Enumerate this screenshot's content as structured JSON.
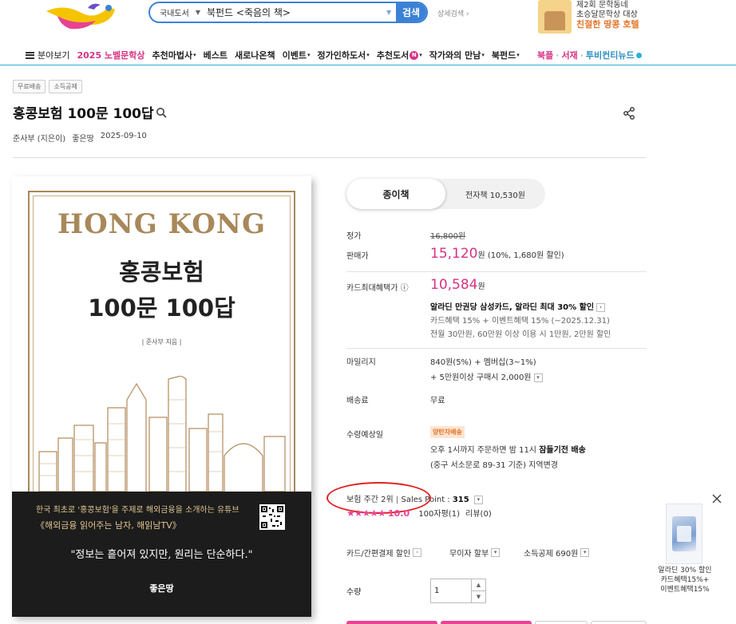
{
  "header": {
    "search_scope": "국내도서",
    "search_value": "북펀드 <죽음의 책>",
    "search_button": "검색",
    "advanced_search": "상세검색",
    "promo_lines": [
      "제2회 문학동네",
      "초승달문학상 대상"
    ],
    "promo_highlight": "친절한 땅콩 호텔"
  },
  "nav": {
    "items": [
      {
        "label": "분야보기",
        "dropdown": false
      },
      {
        "label": "2025 노벨문학상",
        "dropdown": false
      },
      {
        "label": "추천마법사",
        "dropdown": true
      },
      {
        "label": "베스트",
        "dropdown": false
      },
      {
        "label": "새로나온책",
        "dropdown": false
      },
      {
        "label": "이벤트",
        "dropdown": true
      },
      {
        "label": "정가인하도서",
        "dropdown": true
      },
      {
        "label": "추천도서",
        "dropdown": true,
        "badge": "N"
      },
      {
        "label": "작가와의 만남",
        "dropdown": true
      },
      {
        "label": "북펀드",
        "dropdown": true
      }
    ],
    "right": [
      "북플",
      "서재",
      "투비컨티뉴드"
    ]
  },
  "product": {
    "tags": [
      "무료배송",
      "소득공제"
    ],
    "title": "홍콩보험 100문 100답",
    "author": "준사부 (지은이)",
    "publisher": "좋은땅",
    "date": "2025-09-10"
  },
  "cover": {
    "title_en": "HONG KONG",
    "title_ko_1": "홍콩보험",
    "title_ko_2": "100문 100답",
    "author": "| 준사부 지음 |",
    "band_line1": "한국 최초로 '홍콩보험'을 주제로 해외금융을 소개하는 유튜브",
    "band_line2": "《해외금융 읽어주는 남자, 해읽남TV》",
    "quote": "\"정보는 흩어져 있지만, 원리는 단순하다.\"",
    "publisher": "좋은땅"
  },
  "format_tabs": {
    "paper": "종이책",
    "ebook": "전자책 10,530원"
  },
  "pricing": {
    "list_label": "정가",
    "list_price": "16,800원",
    "sale_label": "판매가",
    "sale_price": "15,120",
    "sale_unit": "원",
    "sale_note": "(10%, 1,680원 할인)",
    "card_label": "카드최대혜택가",
    "card_price": "10,584",
    "card_unit": "원",
    "card_line1": "알라딘 만권당 삼성카드, 알라딘 최대 30% 할인",
    "card_line2": "카드혜택 15% + 이벤트혜택 15% (~2025.12.31)",
    "card_line3": "전월 30만원, 60만원 이상 이용 시 1만원, 2만원 할인"
  },
  "mileage": {
    "label": "마일리지",
    "line1": "840원(5%) + 멤버십(3~1%)",
    "line2": "+ 5만원이상 구매시 2,000원"
  },
  "shipping": {
    "label": "배송료",
    "value": "무료"
  },
  "delivery": {
    "label": "수령예상일",
    "badge": "양탄자배송",
    "line1_pre": "오후 1시까지 주문하면 밤 11시 ",
    "line1_bold": "잠들기전 배송",
    "line2": "(중구 서소문로 89-31 기준) 지역변경"
  },
  "ranking": {
    "text": "보험 주간 2위",
    "sales_point": "Sales Point : ",
    "sales_value": "315",
    "rating": 10.0,
    "rating_text": "10.0",
    "hundred_char": "100자평(1)",
    "review": "리뷰(0)"
  },
  "options": {
    "card_discount": "카드/간편결제 할인",
    "installment": "무이자 할부",
    "tax_deduction": "소득공제 690원"
  },
  "quantity": {
    "label": "수량",
    "value": "1"
  },
  "side_ad": {
    "line1": "알라딘 30% 할인",
    "line2": "카드혜택15%+",
    "line3": "이벤트혜택15%"
  }
}
